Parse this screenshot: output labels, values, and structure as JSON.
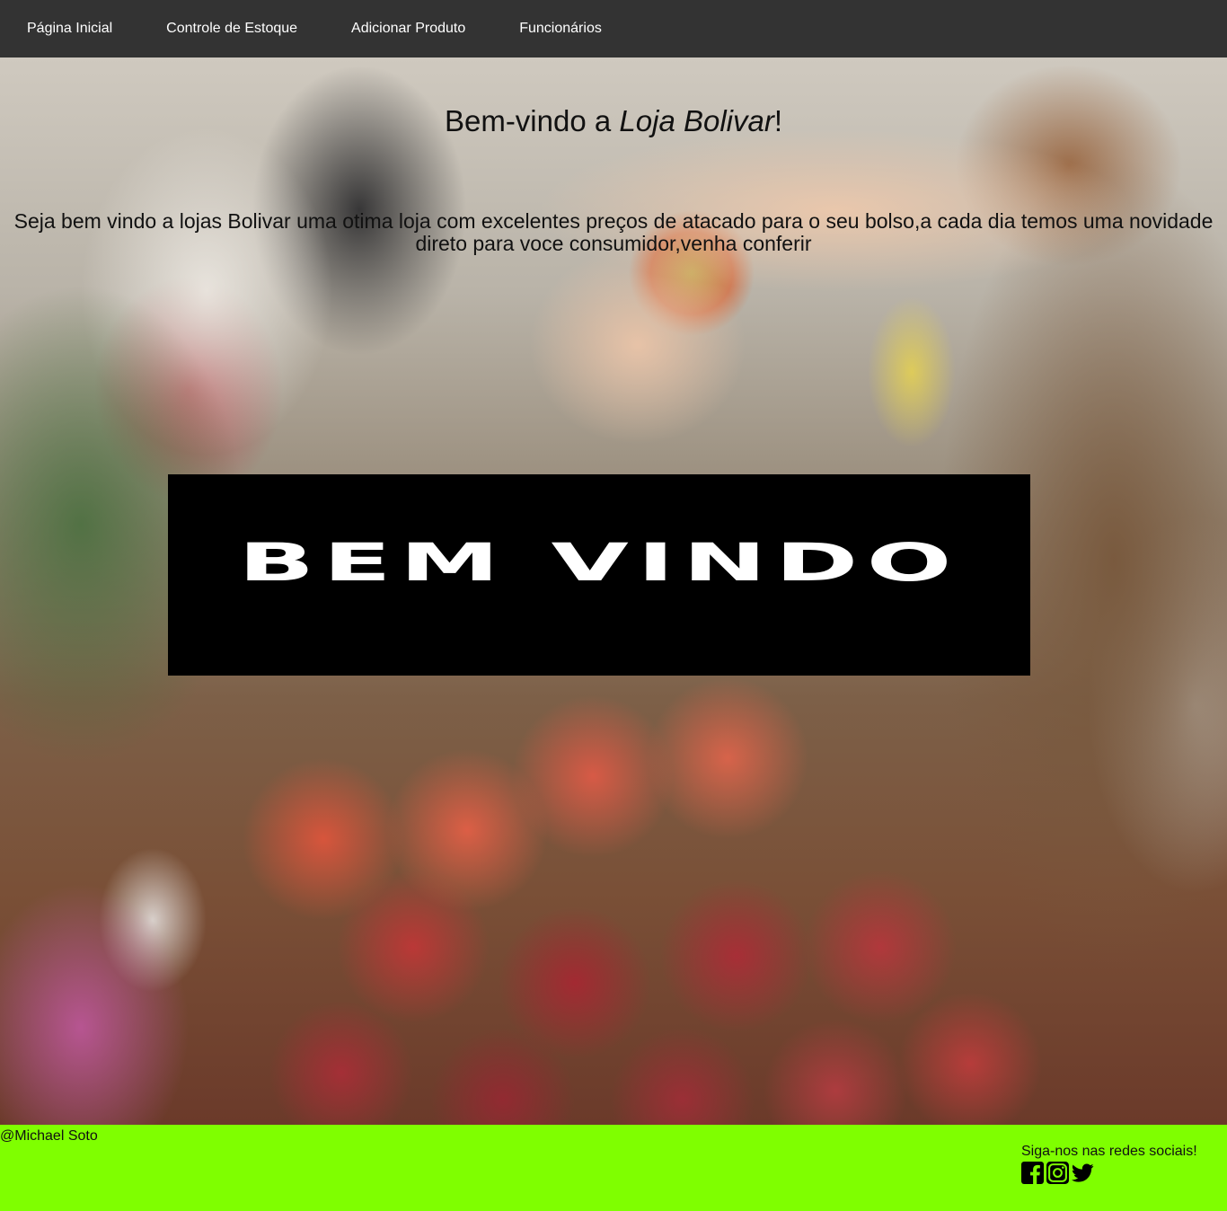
{
  "nav": {
    "items": [
      {
        "label": "Página Inicial"
      },
      {
        "label": "Controle de Estoque"
      },
      {
        "label": "Adicionar Produto"
      },
      {
        "label": "Funcionários"
      }
    ]
  },
  "hero": {
    "title_prefix": "Bem-vindo a ",
    "title_brand": "Loja Bolivar",
    "title_suffix": "!",
    "text": "Seja bem vindo a lojas Bolivar uma otima loja com excelentes preços de atacado para o seu bolso,a cada dia temos uma novidade direto para voce consumidor,venha conferir",
    "banner_text": "BEM VINDO"
  },
  "footer": {
    "credit": "@Michael Soto",
    "social_label": "Siga-nos nas redes sociais!",
    "icons": [
      "facebook-icon",
      "instagram-icon",
      "twitter-icon"
    ],
    "background_color": "#7fff00"
  },
  "colors": {
    "navbar": "#333333",
    "nav_text": "#ffffff",
    "banner_bg": "#000000",
    "banner_text": "#ffffff"
  }
}
